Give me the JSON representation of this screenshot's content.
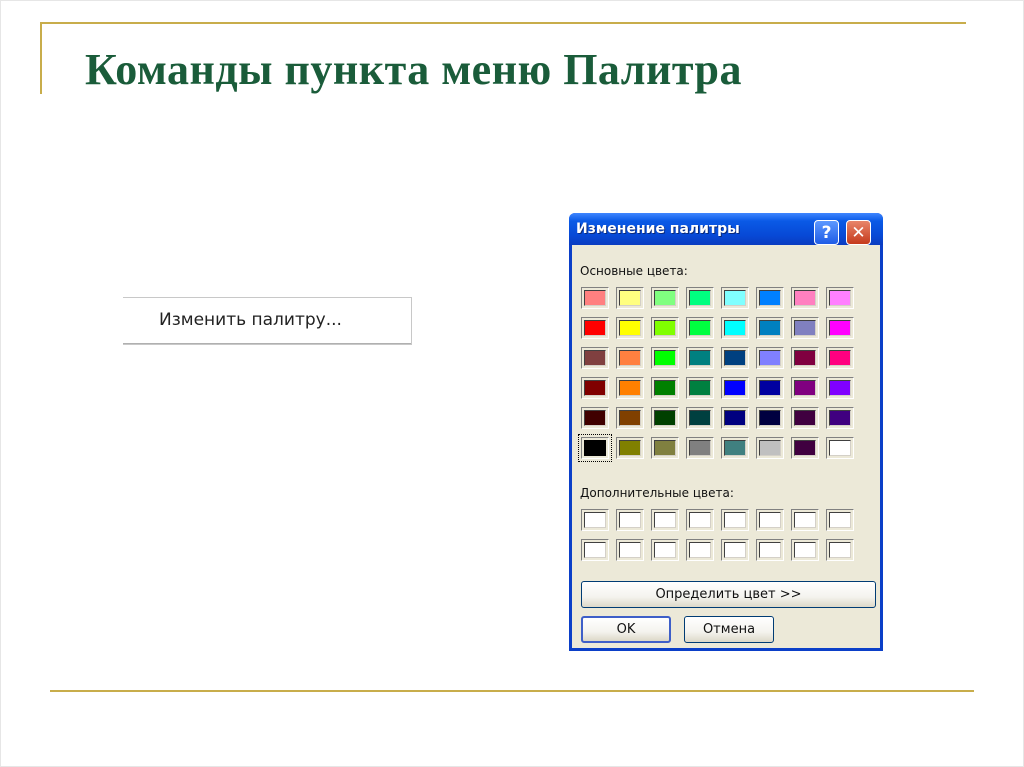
{
  "slide": {
    "title": "Команды пункта меню Палитра",
    "menu_command": "Изменить палитру..."
  },
  "dialog": {
    "title": "Изменение палитры",
    "help_label": "?",
    "close_label": "✕",
    "basic_colors_label": "Основные цвета:",
    "custom_colors_label": "Дополнительные цвета:",
    "define_button": "Определить цвет >>",
    "ok_button": "OK",
    "cancel_button": "Отмена",
    "basic_colors": [
      [
        "#ff8080",
        "#ffff80",
        "#80ff80",
        "#00ff80",
        "#80ffff",
        "#0080ff",
        "#ff80c0",
        "#ff80ff"
      ],
      [
        "#ff0000",
        "#ffff00",
        "#80ff00",
        "#00ff40",
        "#00ffff",
        "#0080c0",
        "#8080c0",
        "#ff00ff"
      ],
      [
        "#804040",
        "#ff8040",
        "#00ff00",
        "#008080",
        "#004080",
        "#8080ff",
        "#800040",
        "#ff0080"
      ],
      [
        "#800000",
        "#ff8000",
        "#008000",
        "#008040",
        "#0000ff",
        "#0000a0",
        "#800080",
        "#8000ff"
      ],
      [
        "#400000",
        "#804000",
        "#004000",
        "#004040",
        "#000080",
        "#000040",
        "#400040",
        "#400080"
      ],
      [
        "#000000",
        "#808000",
        "#808040",
        "#808080",
        "#408080",
        "#c0c0c0",
        "#400040",
        "#ffffff"
      ]
    ],
    "selected_color": "#000000",
    "custom_color_rows": 2,
    "custom_color_cols": 8
  }
}
